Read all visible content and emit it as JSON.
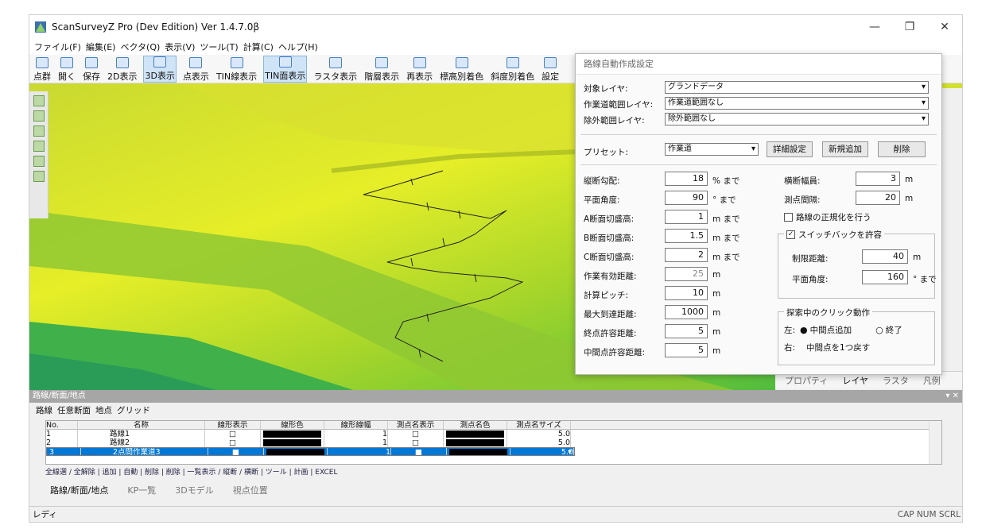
{
  "window": {
    "title": "ScanSurveyZ Pro  (Dev Edition)  Ver 1.4.7.0β",
    "controls": [
      "—",
      "❐",
      "✕"
    ]
  },
  "menu": [
    "ファイル(F)",
    "編集(E)",
    "ベクタ(Q)",
    "表示(V)",
    "ツール(T)",
    "計算(C)",
    "ヘルプ(H)"
  ],
  "toolbar": [
    "点群",
    "開く",
    "保存",
    "2D表示",
    "3D表示",
    "点表示",
    "TIN線表示",
    "TIN面表示",
    "ラスタ表示",
    "階層表示",
    "再表示",
    "標高別着色",
    "斜度別着色",
    "設定"
  ],
  "dialog": {
    "title": "路線自動作成設定",
    "target_layer_label": "対象レイヤ:",
    "target_layer_value": "グランドデータ",
    "work_area_label": "作業道範囲レイヤ:",
    "work_area_value": "作業道範囲なし",
    "exclude_label": "除外範囲レイヤ:",
    "exclude_value": "除外範囲なし",
    "preset_label": "プリセット:",
    "preset_value": "作業道",
    "detail_button": "詳細設定",
    "new_button": "新規追加",
    "delete_button": "削除",
    "params": [
      {
        "label": "縦断勾配:",
        "value": "18",
        "unit": "% まで"
      },
      {
        "label": "平面角度:",
        "value": "90",
        "unit": "° まで"
      },
      {
        "label": "A断面切盛高:",
        "value": "1",
        "unit": "m まで"
      },
      {
        "label": "B断面切盛高:",
        "value": "1.5",
        "unit": "m まで"
      },
      {
        "label": "C断面切盛高:",
        "value": "2",
        "unit": "m まで"
      },
      {
        "label": "作業有効距離:",
        "value": "25",
        "unit": "m"
      },
      {
        "label": "計算ピッチ:",
        "value": "10",
        "unit": "m"
      },
      {
        "label": "最大到達距離:",
        "value": "1000",
        "unit": "m"
      },
      {
        "label": "終点許容距離:",
        "value": "5",
        "unit": "m"
      },
      {
        "label": "中間点許容距離:",
        "value": "5",
        "unit": "m"
      }
    ],
    "width_label": "横断幅員:",
    "width_value": "3",
    "width_unit": "m",
    "spacing_label": "測点間隔:",
    "spacing_value": "20",
    "spacing_unit": "m",
    "normalize_label": "路線の正規化を行う",
    "switchback_label": "スイッチバックを許容",
    "limit_dist_label": "制限距離:",
    "limit_dist_value": "40",
    "limit_dist_unit": "m",
    "plane_angle_label": "平面角度:",
    "plane_angle_value": "160",
    "plane_angle_unit": "° まで",
    "click_group_label": "探索中のクリック動作",
    "left_label": "左:",
    "left_opt1": "中間点追加",
    "left_opt2": "終了",
    "right_label": "右:",
    "right_action": "中間点を1つ戻す"
  },
  "right_tabs": [
    "プロパティ",
    "レイヤ",
    "ラスタ",
    "凡例"
  ],
  "bottom": {
    "panel_title": "路線/断面/地点",
    "subtabs": [
      "路線",
      "任意断面",
      "地点",
      "グリッド"
    ],
    "columns": [
      "No.",
      "名称",
      "線形表示",
      "線形色",
      "線形線幅",
      "測点名表示",
      "測点名色",
      "測点名サイズ"
    ],
    "rows": [
      {
        "no": "1",
        "name": "路線1",
        "show": "□",
        "width": "1",
        "pshow": "□",
        "size": "5.0"
      },
      {
        "no": "2",
        "name": "路線2",
        "show": "□",
        "width": "1",
        "pshow": "□",
        "size": "5.0"
      },
      {
        "no": "3",
        "name": "2点間作業道3",
        "show": "■",
        "width": "1",
        "pshow": "■",
        "size": "5.0"
      }
    ],
    "tools": "全線選 / 全解除 | 追加 | 自動 | 削除 | 削除 | 一覧表示 / 縦断 / 横断 | ツール | 計画 | EXCEL",
    "tabs": [
      "路線/断面/地点",
      "KP一覧",
      "3Dモデル",
      "視点位置"
    ]
  },
  "status": {
    "left": "レディ",
    "right": "CAP NUM SCRL"
  }
}
